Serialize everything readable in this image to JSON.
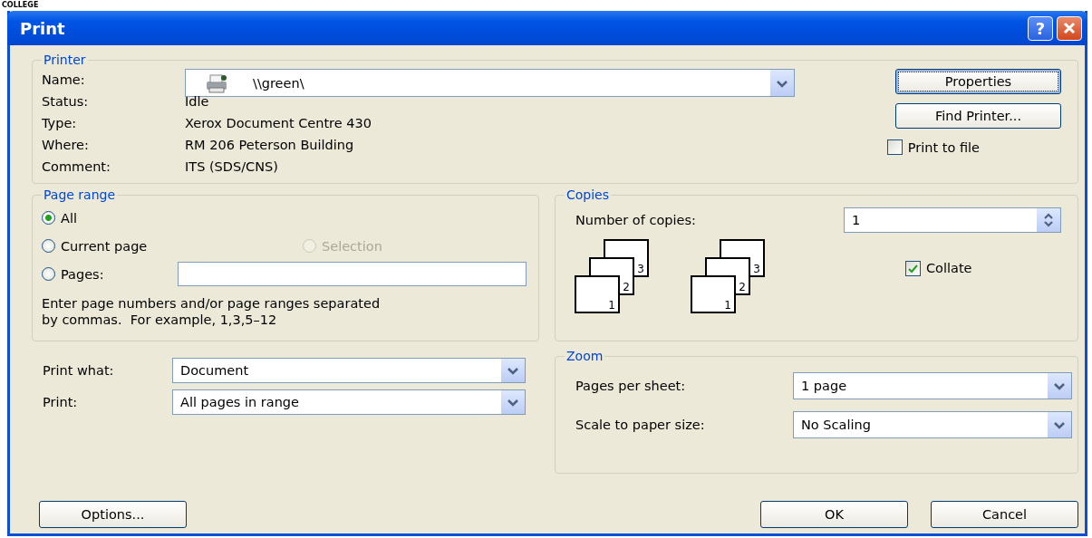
{
  "caption": "COLLEGE",
  "window": {
    "title": "Print",
    "help": "?"
  },
  "printer": {
    "legend": "Printer",
    "name_label": "Name:",
    "name_value": "\\\\green\\",
    "info": [
      {
        "label": "Status:",
        "value": "Idle"
      },
      {
        "label": "Type:",
        "value": "Xerox Document Centre 430"
      },
      {
        "label": "Where:",
        "value": "RM 206 Peterson Building"
      },
      {
        "label": "Comment:",
        "value": "ITS (SDS/CNS)"
      }
    ],
    "buttons": [
      {
        "label": "Properties",
        "focused": true
      },
      {
        "label": "Find Printer...",
        "focused": false
      }
    ],
    "print_to_file": {
      "label": "Print to file",
      "checked": false
    }
  },
  "page_range": {
    "legend": "Page range",
    "options": [
      {
        "label": "All",
        "kind": "radio",
        "selected": true,
        "disabled": false
      },
      {
        "label": "Current page",
        "kind": "radio",
        "selected": false,
        "disabled": false
      },
      {
        "label": "Selection",
        "kind": "radio",
        "selected": false,
        "disabled": true
      },
      {
        "label": "Pages:",
        "kind": "radio_with_field",
        "selected": false,
        "disabled": false
      }
    ],
    "hint": "Enter page numbers and/or page ranges separated by commas.  For example, 1,3,5–12"
  },
  "print_what": [
    {
      "label": "Print what:",
      "value": "Document"
    },
    {
      "label": "Print:",
      "value": "All pages in range"
    }
  ],
  "copies": {
    "legend": "Copies",
    "count_label": "Number of copies:",
    "count": "1",
    "stacks": [
      [
        "1",
        "2",
        "3"
      ],
      [
        "1",
        "2",
        "3"
      ]
    ],
    "collate": {
      "label": "Collate",
      "checked": true
    }
  },
  "zoom": {
    "legend": "Zoom",
    "rows": [
      {
        "label": "Pages per sheet:",
        "value": "1 page"
      },
      {
        "label": "Scale to paper size:",
        "value": "No Scaling"
      }
    ]
  },
  "footer": {
    "options": "Options...",
    "ok": "OK",
    "cancel": "Cancel"
  }
}
